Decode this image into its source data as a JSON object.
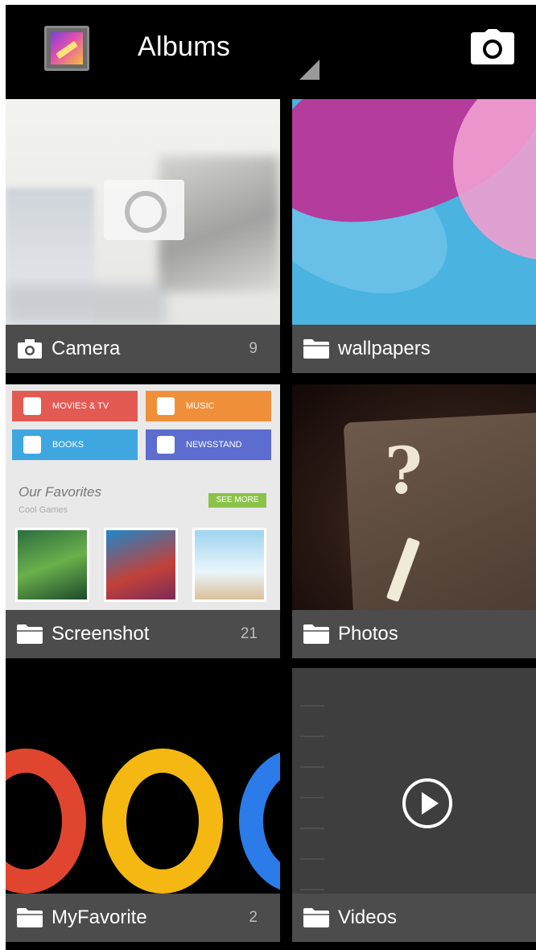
{
  "action_bar": {
    "title": "Albums",
    "app_icon": "gallery-app-icon",
    "camera_icon": "camera-icon"
  },
  "albums": [
    {
      "name": "Camera",
      "count": "9",
      "icon": "camera-icon"
    },
    {
      "name": "wallpapers",
      "count": "",
      "icon": "folder-icon"
    },
    {
      "name": "Screenshot",
      "count": "21",
      "icon": "folder-icon"
    },
    {
      "name": "Photos",
      "count": "",
      "icon": "folder-icon"
    },
    {
      "name": "MyFavorite",
      "count": "2",
      "icon": "folder-icon"
    },
    {
      "name": "Videos",
      "count": "",
      "icon": "folder-icon"
    }
  ],
  "screenshot_thumb": {
    "categories": [
      "MOVIES & TV",
      "MUSIC",
      "BOOKS",
      "NEWSSTAND"
    ],
    "favorites_title": "Our Favorites",
    "favorites_subtitle": "Cool Games",
    "see_more": "SEE MORE"
  },
  "colors": {
    "movies": "#e35a53",
    "music": "#f08f3a",
    "books": "#3ea7df",
    "newsstand": "#5c6dcf",
    "google_red": "#e0462f",
    "google_yellow": "#f5b812",
    "google_blue": "#2b7be8"
  }
}
